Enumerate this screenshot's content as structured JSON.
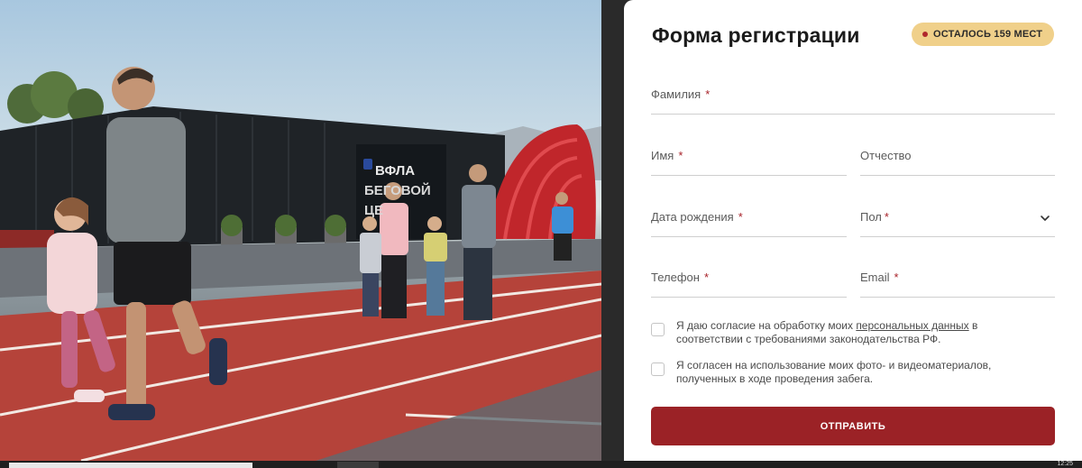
{
  "photo": {
    "building_sign": [
      "ВФЛА",
      "БЕГОВОЙ",
      "ЦЕ"
    ]
  },
  "form": {
    "title": "Форма регистрации",
    "badge": "ОСТАЛОСЬ 159 МЕСТ",
    "fields": {
      "last_name": "Фамилия",
      "first_name": "Имя",
      "middle_name": "Отчество",
      "birth_date": "Дата рождения",
      "gender": "Пол",
      "phone": "Телефон",
      "email": "Email"
    },
    "required_mark": "*",
    "consent1": {
      "before": "Я даю согласие на обработку моих ",
      "link": "персональных данных",
      "after": " в соответствии с требованиями законодательства РФ."
    },
    "consent2": "Я согласен на использование моих фото- и видеоматериалов, полученных в ходе проведения забега.",
    "submit": "ОТПРАВИТЬ"
  },
  "colors": {
    "accent": "#9b2226",
    "badge_bg": "#f0d08a",
    "track": "#b5433a"
  },
  "taskbar": {
    "clock": "12:25"
  }
}
